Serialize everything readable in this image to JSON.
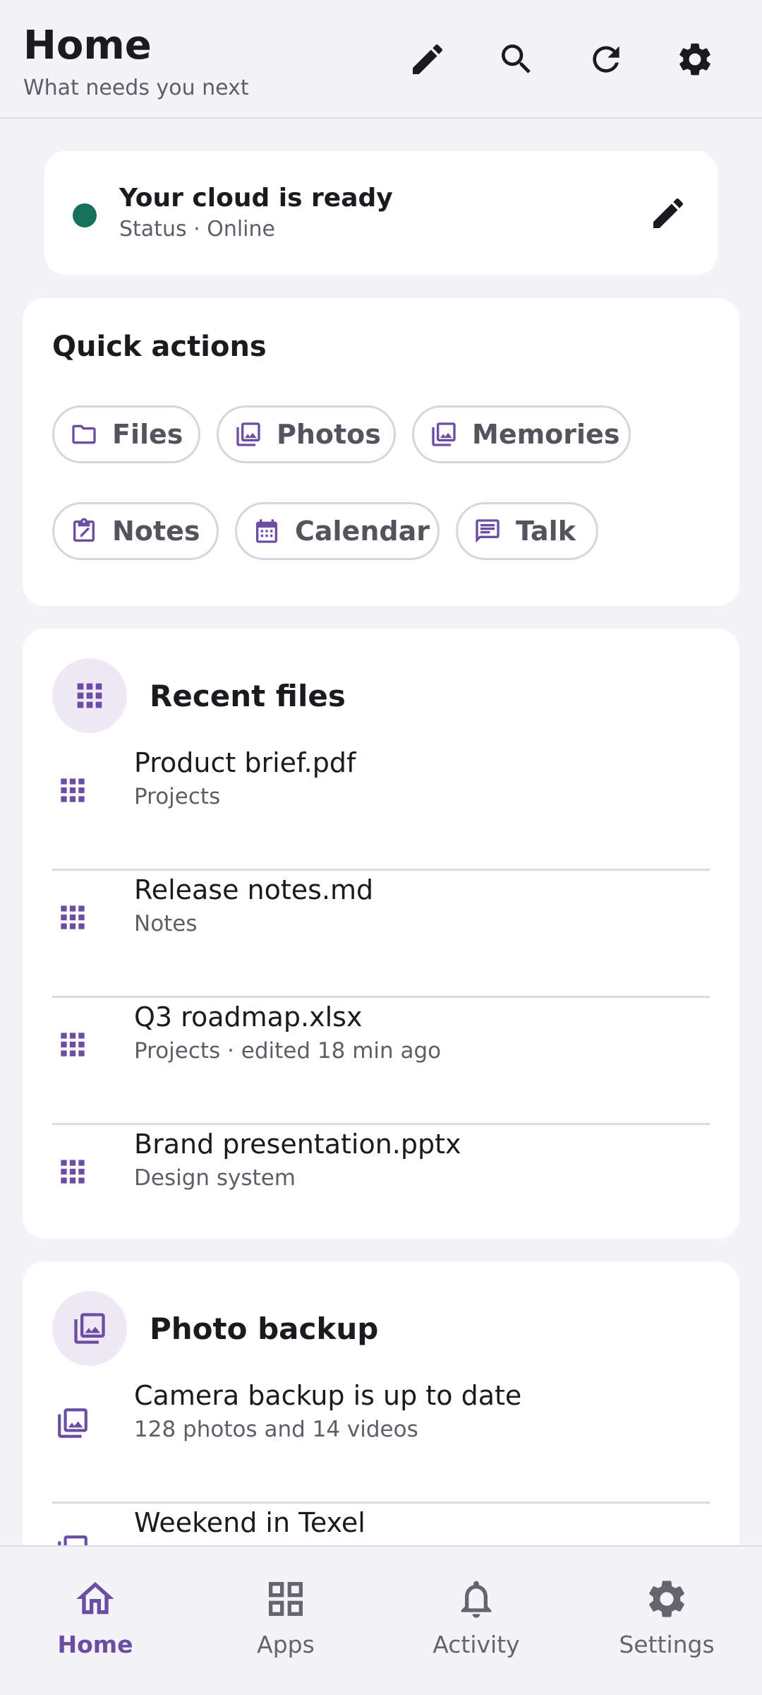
{
  "header": {
    "title": "Home",
    "subtitle": "What needs you next",
    "actions": [
      "edit-icon",
      "search-icon",
      "refresh-icon",
      "settings-icon"
    ]
  },
  "status": {
    "title": "Your cloud is ready",
    "subtitle": "Status · Online",
    "dot_color": "#18705e"
  },
  "quick_actions": {
    "title": "Quick actions",
    "items": [
      {
        "label": "Files",
        "icon": "folder-icon"
      },
      {
        "label": "Photos",
        "icon": "photos-icon"
      },
      {
        "label": "Memories",
        "icon": "photos-icon"
      },
      {
        "label": "Notes",
        "icon": "notes-icon"
      },
      {
        "label": "Calendar",
        "icon": "calendar-icon"
      },
      {
        "label": "Talk",
        "icon": "chat-icon"
      }
    ]
  },
  "recent_files": {
    "title": "Recent files",
    "items": [
      {
        "name": "Product brief.pdf",
        "meta": "Projects"
      },
      {
        "name": "Release notes.md",
        "meta": "Notes"
      },
      {
        "name": "Q3 roadmap.xlsx",
        "meta": "Projects · edited 18 min ago"
      },
      {
        "name": "Brand presentation.pptx",
        "meta": "Design system"
      }
    ]
  },
  "photo_backup": {
    "title": "Photo backup",
    "items": [
      {
        "name": "Camera backup is up to date",
        "meta": "128 photos and 14 videos"
      },
      {
        "name": "Weekend in Texel",
        "meta": ""
      }
    ]
  },
  "nav": {
    "items": [
      {
        "label": "Home",
        "icon": "home-icon",
        "active": true
      },
      {
        "label": "Apps",
        "icon": "apps-icon",
        "active": false
      },
      {
        "label": "Activity",
        "icon": "bell-icon",
        "active": false
      },
      {
        "label": "Settings",
        "icon": "settings-icon",
        "active": false
      }
    ]
  },
  "colors": {
    "accent": "#6b4ea4",
    "accent_soft": "#efe8f7",
    "background": "#f4f3f8"
  }
}
